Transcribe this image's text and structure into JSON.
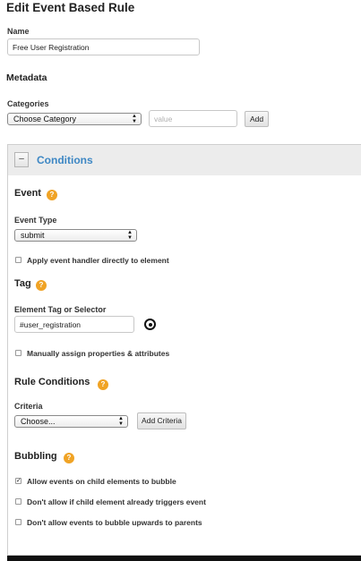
{
  "page": {
    "title": "Edit Event Based Rule"
  },
  "name_field": {
    "label": "Name",
    "value": "Free User Registration"
  },
  "metadata": {
    "heading": "Metadata"
  },
  "categories": {
    "label": "Categories",
    "select_value": "Choose Category",
    "value_placeholder": "value",
    "add_label": "Add"
  },
  "conditions": {
    "collapse_label": "–",
    "title": "Conditions",
    "event": {
      "heading": "Event",
      "help": "?",
      "type_label": "Event Type",
      "type_value": "submit",
      "apply_directly_label": "Apply event handler directly to element",
      "apply_directly_checked": false
    },
    "tag": {
      "heading": "Tag",
      "help": "?",
      "selector_label": "Element Tag or Selector",
      "selector_value": "#user_registration",
      "manual_assign_label": "Manually assign properties & attributes",
      "manual_assign_checked": false
    },
    "rule_conditions": {
      "heading": "Rule Conditions",
      "help": "?",
      "criteria_label": "Criteria",
      "criteria_value": "Choose...",
      "add_criteria_label": "Add Criteria"
    },
    "bubbling": {
      "heading": "Bubbling",
      "help": "?",
      "options": [
        {
          "label": "Allow events on child elements to bubble",
          "checked": true
        },
        {
          "label": "Don't allow if child element already triggers event",
          "checked": false
        },
        {
          "label": "Don't allow events to bubble upwards to parents",
          "checked": false
        }
      ]
    }
  },
  "icons": {
    "select_arrows": "updown-chevron-icon",
    "element_picker": "target-icon",
    "help": "question-icon",
    "checkmark": "checkmark-icon"
  },
  "colors": {
    "accent": "#3d87c4",
    "help_badge": "#f0a325",
    "panel_header": "#ececec"
  }
}
